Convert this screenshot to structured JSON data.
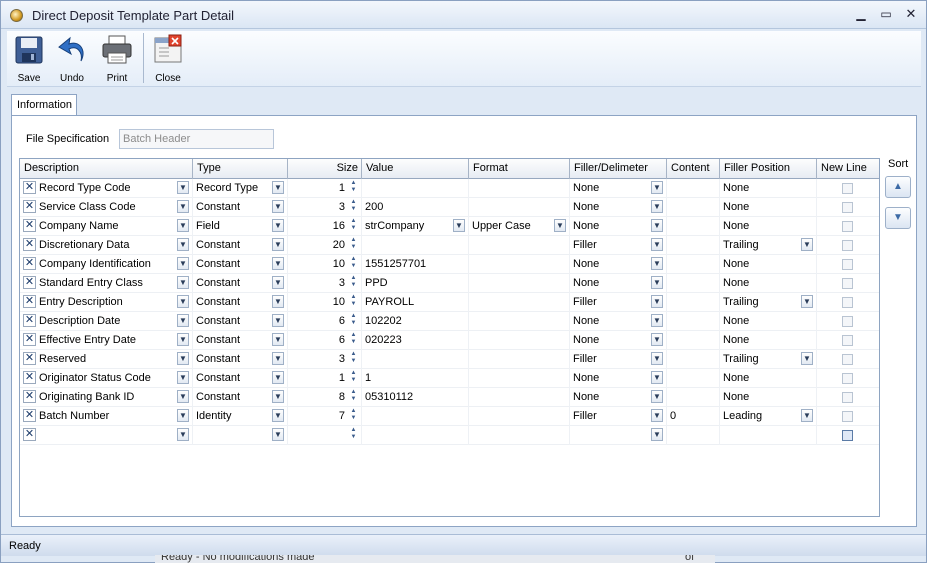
{
  "window": {
    "title": "Direct Deposit Template Part Detail"
  },
  "toolbar": {
    "save": "Save",
    "undo": "Undo",
    "print": "Print",
    "close": "Close"
  },
  "tab": {
    "label": "Information"
  },
  "file_spec": {
    "label": "File Specification",
    "placeholder": "Batch Header"
  },
  "grid": {
    "headers": [
      "Description",
      "Type",
      "Size",
      "Value",
      "Format",
      "Filler/Delimeter",
      "Content",
      "Filler Position",
      "New Line"
    ],
    "rows": [
      {
        "description": "Record Type Code",
        "type": "Record Type",
        "size": "1",
        "value": "",
        "format": "",
        "filler": "None",
        "content": "",
        "position": "None",
        "pos_dd": false,
        "val_dd": false,
        "fmt_dd": false
      },
      {
        "description": "Service Class Code",
        "type": "Constant",
        "size": "3",
        "value": "200",
        "format": "",
        "filler": "None",
        "content": "",
        "position": "None",
        "pos_dd": false,
        "val_dd": false,
        "fmt_dd": false
      },
      {
        "description": "Company Name",
        "type": "Field",
        "size": "16",
        "value": "strCompany",
        "format": "Upper Case",
        "filler": "None",
        "content": "",
        "position": "None",
        "pos_dd": false,
        "val_dd": true,
        "fmt_dd": true
      },
      {
        "description": "Discretionary Data",
        "type": "Constant",
        "size": "20",
        "value": "",
        "format": "",
        "filler": "Filler",
        "content": "",
        "position": "Trailing",
        "pos_dd": true,
        "val_dd": false,
        "fmt_dd": false
      },
      {
        "description": "Company Identification",
        "type": "Constant",
        "size": "10",
        "value": "1551257701",
        "format": "",
        "filler": "None",
        "content": "",
        "position": "None",
        "pos_dd": false,
        "val_dd": false,
        "fmt_dd": false
      },
      {
        "description": "Standard Entry Class",
        "type": "Constant",
        "size": "3",
        "value": "PPD",
        "format": "",
        "filler": "None",
        "content": "",
        "position": "None",
        "pos_dd": false,
        "val_dd": false,
        "fmt_dd": false
      },
      {
        "description": "Entry Description",
        "type": "Constant",
        "size": "10",
        "value": "PAYROLL",
        "format": "",
        "filler": "Filler",
        "content": "",
        "position": "Trailing",
        "pos_dd": true,
        "val_dd": false,
        "fmt_dd": false
      },
      {
        "description": "Description Date",
        "type": "Constant",
        "size": "6",
        "value": "102202",
        "format": "",
        "filler": "None",
        "content": "",
        "position": "None",
        "pos_dd": false,
        "val_dd": false,
        "fmt_dd": false
      },
      {
        "description": "Effective Entry Date",
        "type": "Constant",
        "size": "6",
        "value": "020223",
        "format": "",
        "filler": "None",
        "content": "",
        "position": "None",
        "pos_dd": false,
        "val_dd": false,
        "fmt_dd": false
      },
      {
        "description": "Reserved",
        "type": "Constant",
        "size": "3",
        "value": "",
        "format": "",
        "filler": "Filler",
        "content": "",
        "position": "Trailing",
        "pos_dd": true,
        "val_dd": false,
        "fmt_dd": false
      },
      {
        "description": "Originator Status  Code",
        "type": "Constant",
        "size": "1",
        "value": "1",
        "format": "",
        "filler": "None",
        "content": "",
        "position": "None",
        "pos_dd": false,
        "val_dd": false,
        "fmt_dd": false
      },
      {
        "description": "Originating Bank ID",
        "type": "Constant",
        "size": "8",
        "value": "05310112",
        "format": "",
        "filler": "None",
        "content": "",
        "position": "None",
        "pos_dd": false,
        "val_dd": false,
        "fmt_dd": false
      },
      {
        "description": "Batch Number",
        "type": "Identity",
        "size": "7",
        "value": "",
        "format": "",
        "filler": "Filler",
        "content": "0",
        "position": "Leading",
        "pos_dd": true,
        "val_dd": false,
        "fmt_dd": false
      },
      {
        "description": "",
        "type": "",
        "size": "",
        "value": "",
        "format": "",
        "filler": "",
        "content": "",
        "position": "",
        "pos_dd": false,
        "val_dd": false,
        "fmt_dd": false,
        "new_row": true
      }
    ]
  },
  "sort": {
    "label": "Sort"
  },
  "status": {
    "text": "Ready"
  },
  "behind": {
    "left": "Ready - No modifications made",
    "right": "of"
  }
}
